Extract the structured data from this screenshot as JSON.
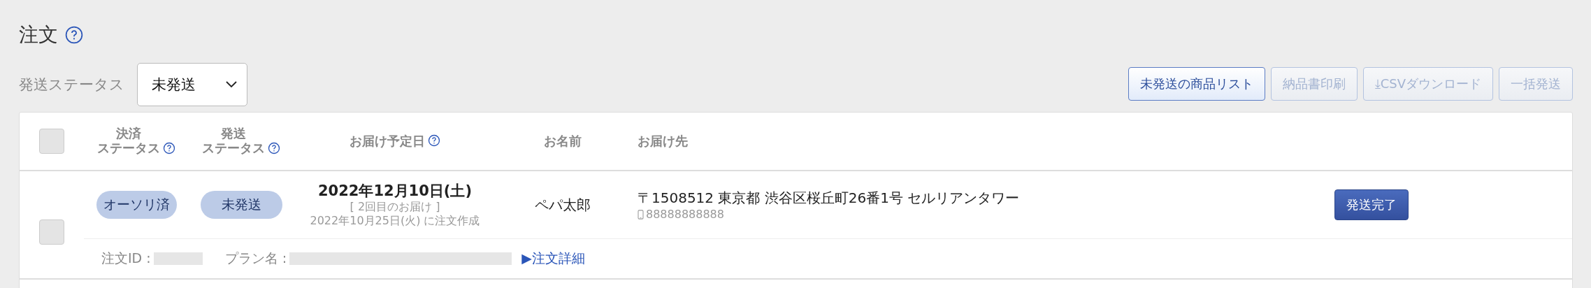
{
  "page": {
    "title": "注文",
    "help": true
  },
  "filter": {
    "label": "発送ステータス",
    "value": "未発送"
  },
  "actions": [
    {
      "label": "未発送の商品リスト",
      "disabled": false
    },
    {
      "label": "納品書印刷",
      "disabled": true
    },
    {
      "label": "⤓CSVダウンロード",
      "disabled": true
    },
    {
      "label": "一括発送",
      "disabled": true
    }
  ],
  "table": {
    "select_all": {
      "checked": false
    },
    "columns": [
      {
        "lines": [
          "決済",
          "ステータス"
        ],
        "help": true
      },
      {
        "lines": [
          "発送",
          "ステータス"
        ],
        "help": true
      },
      {
        "lines": [
          "お届け予定日"
        ],
        "help": true
      },
      {
        "lines": [
          "お名前"
        ],
        "help": false
      },
      {
        "lines": [
          "お届け先"
        ],
        "help": false
      }
    ],
    "rows": [
      {
        "checked": false,
        "payment_status": "オーソリ済",
        "shipping_status": "未発送",
        "delivery_date": "2022年12月10日(土)",
        "delivery_note": "[ 2回目のお届け ]",
        "created": "2022年10月25日(火) に注文作成",
        "name": "ペパ太郎",
        "address": "〒1508512 東京都 渋谷区桜丘町26番1号 セルリアンタワー",
        "phone": "88888888888",
        "action": "発送完了",
        "order_id_label": "注文ID :",
        "plan_label": "プラン名 :",
        "detail_link": "▶注文詳細"
      }
    ]
  }
}
